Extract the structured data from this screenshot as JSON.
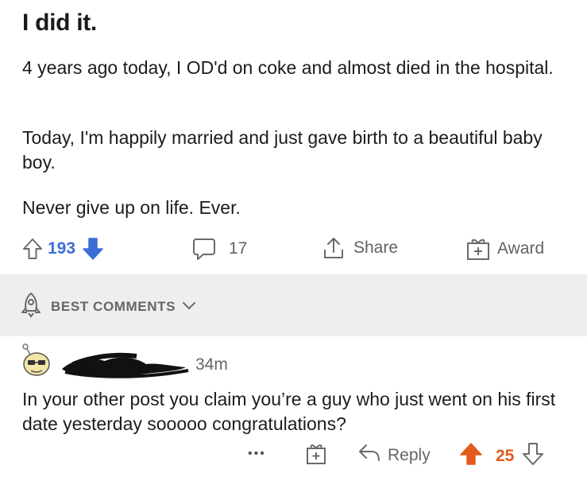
{
  "post": {
    "title": "I did it.",
    "paragraphs": [
      "4 years ago today, I OD'd on coke and almost died in the hospital.",
      "Today, I'm happily married and just gave birth to a beautiful baby boy.",
      "Never give up on life. Ever."
    ],
    "upvotes": "193",
    "comments_count": "17",
    "share_label": "Share",
    "award_label": "Award"
  },
  "sort": {
    "label": "BEST COMMENTS"
  },
  "comment": {
    "time": "34m",
    "text": "In your other post you claim you’re a guy who just went on his first date yesterday sooooo congratulations?",
    "more": "•••",
    "reply_label": "Reply",
    "score": "25"
  },
  "colors": {
    "upvote_blue": "#3d6ed8",
    "comment_upvote_orange": "#e25a1c",
    "band_gray": "#eeeeef"
  }
}
